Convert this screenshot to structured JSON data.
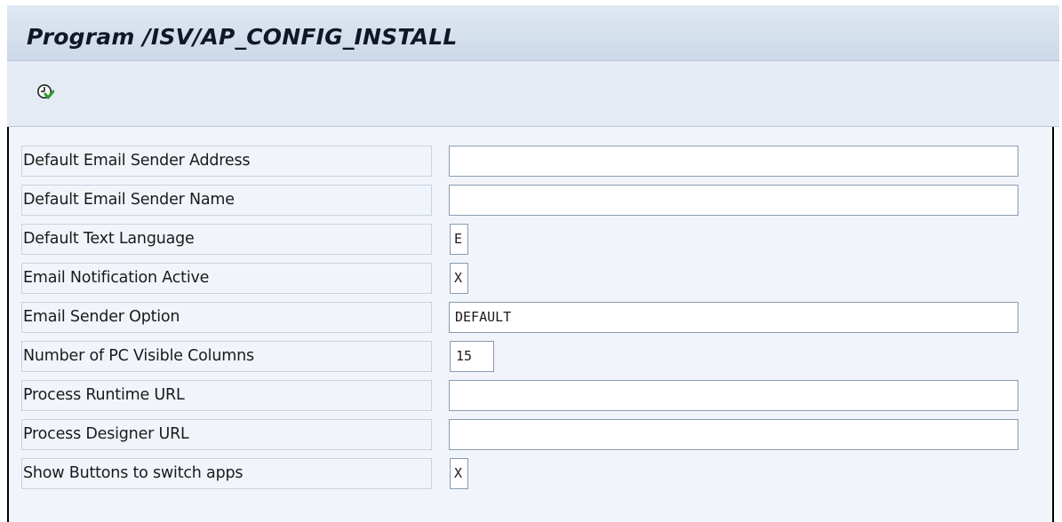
{
  "window": {
    "title": "Program /ISV/AP_CONFIG_INSTALL"
  },
  "toolbar": {
    "execute_icon": "execute-clock-icon"
  },
  "form": {
    "fields": [
      {
        "label": "Default Email Sender Address",
        "value": ""
      },
      {
        "label": "Default Email Sender Name",
        "value": ""
      },
      {
        "label": "Default Text Language",
        "value": "E"
      },
      {
        "label": "Email Notification Active",
        "value": "X"
      },
      {
        "label": "Email Sender Option",
        "value": "DEFAULT"
      },
      {
        "label": "Number of PC Visible Columns",
        "value": "15"
      },
      {
        "label": "Process Runtime URL",
        "value": ""
      },
      {
        "label": "Process Designer URL",
        "value": ""
      },
      {
        "label": "Show Buttons to switch apps",
        "value": "X"
      }
    ]
  },
  "colors": {
    "title_bar": "#cdd9e8",
    "toolbar": "#e4ebf4",
    "background": "#f1f5fb",
    "exec_icon_green": "#2e9b2e"
  }
}
